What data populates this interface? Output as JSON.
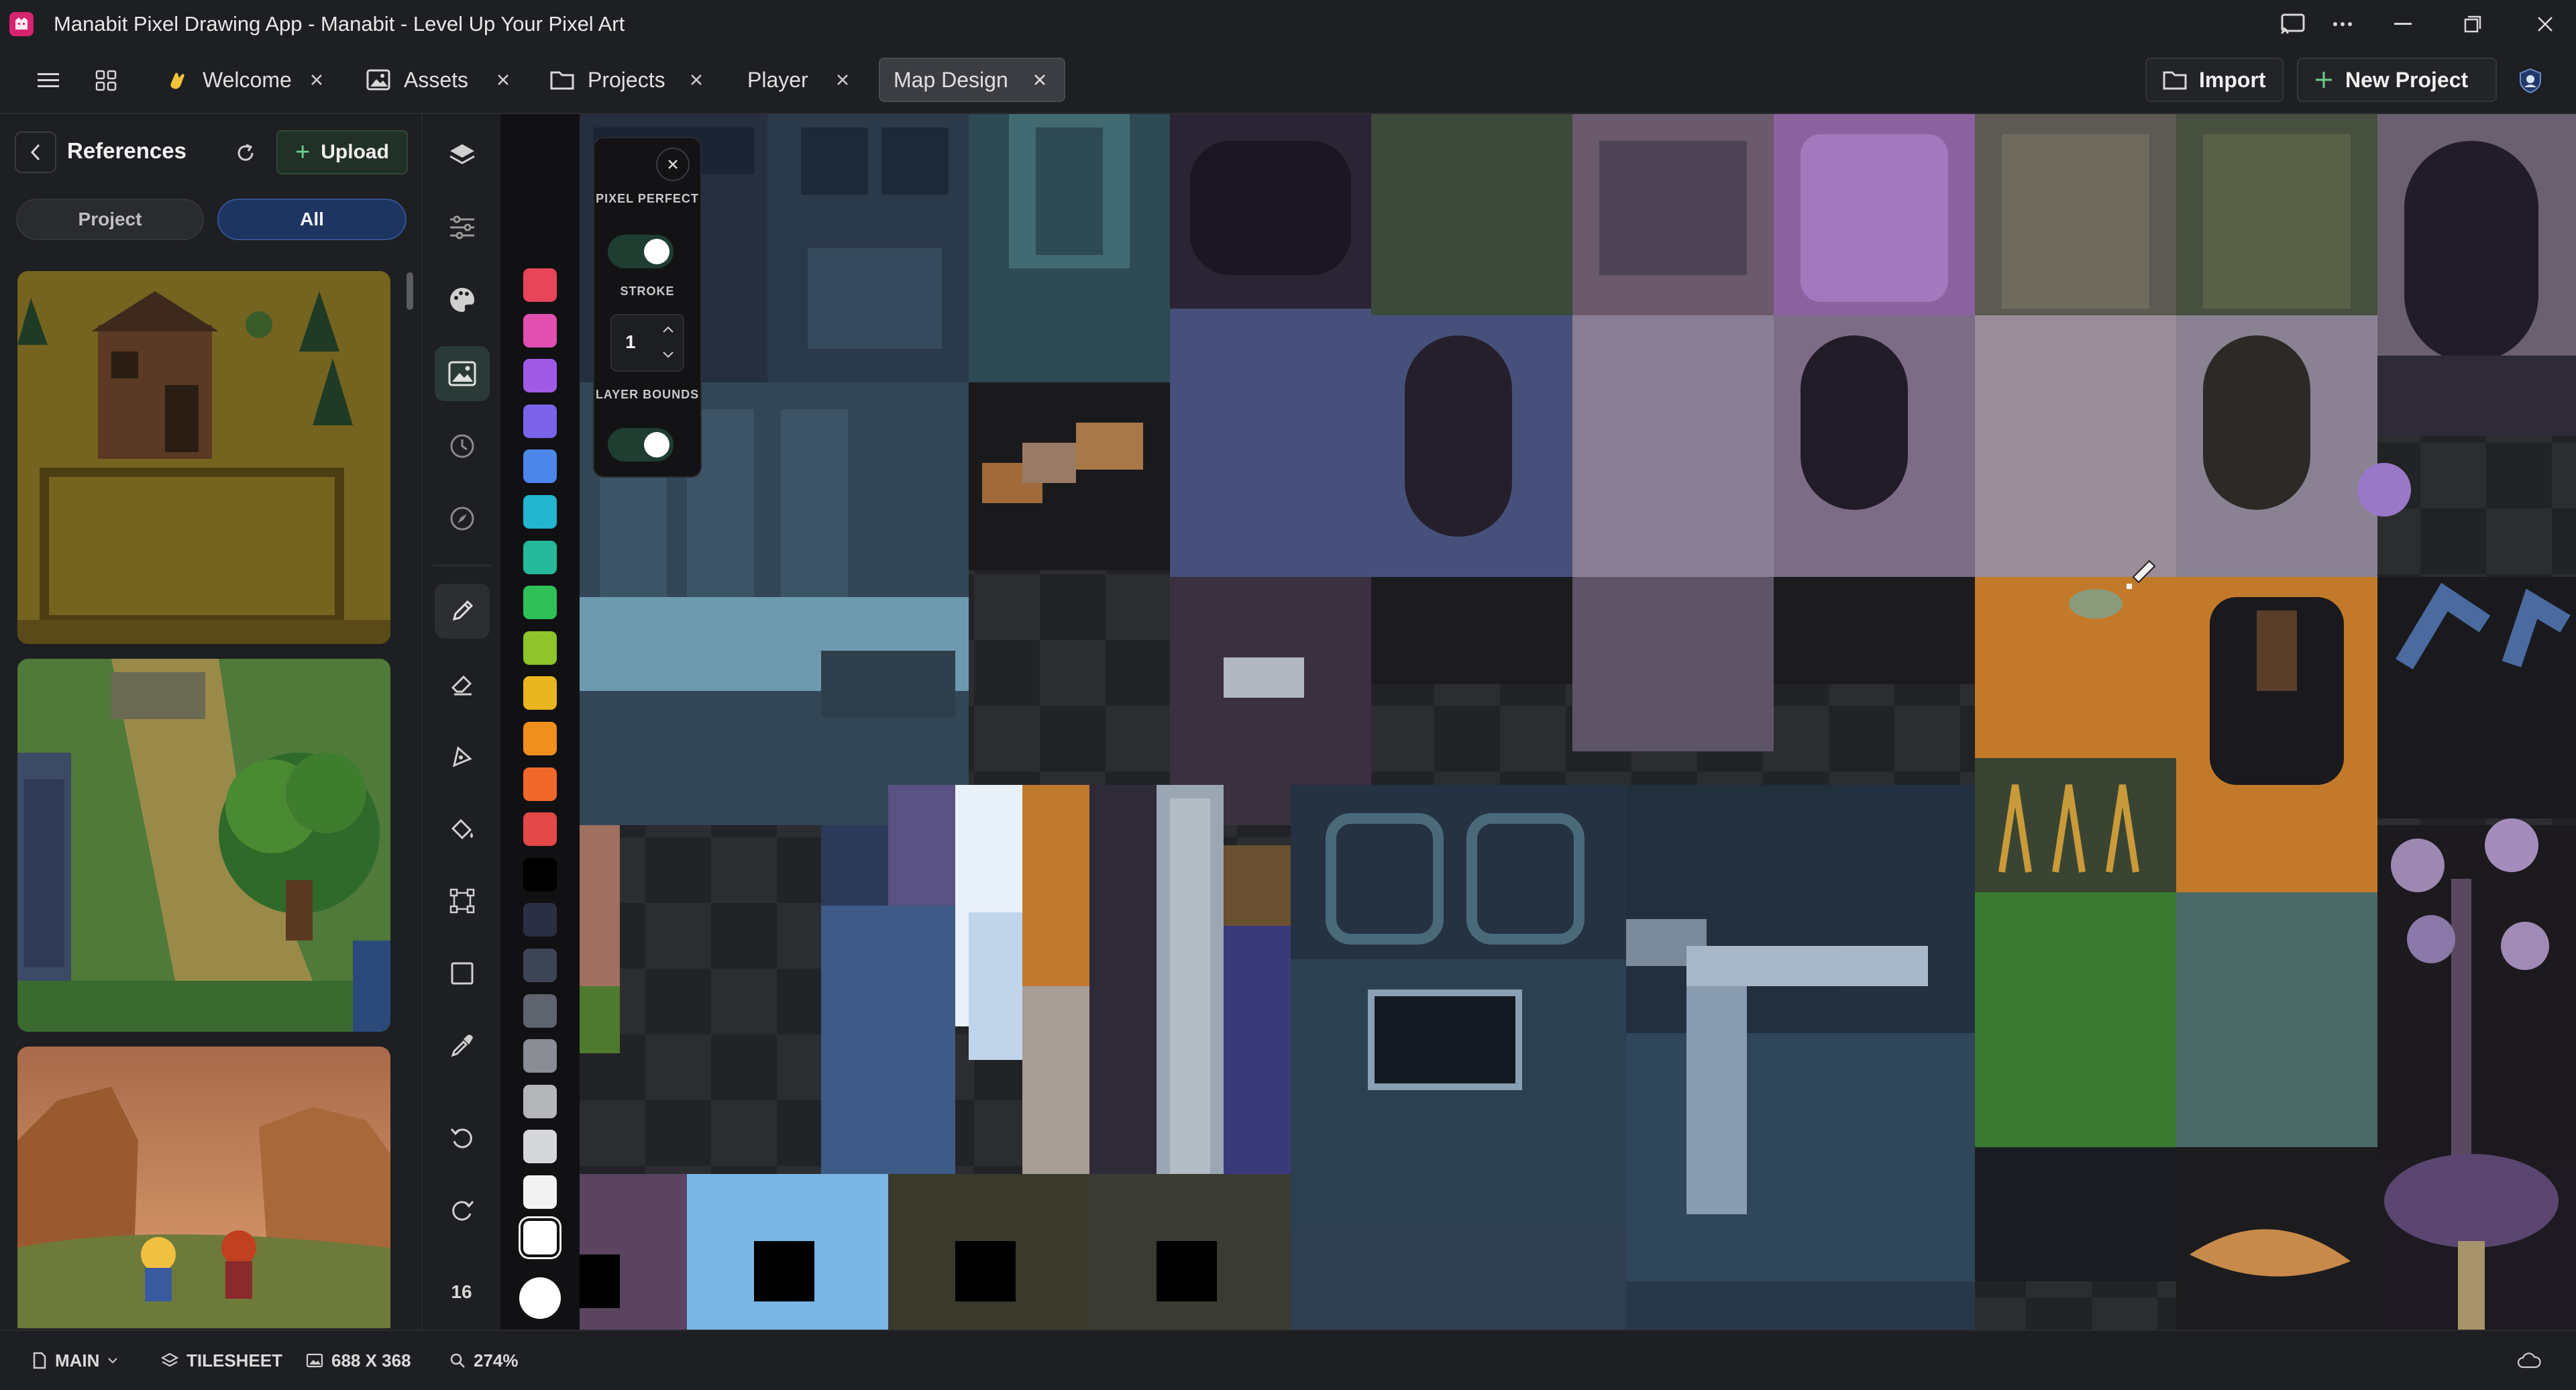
{
  "window": {
    "title": "Manabit Pixel Drawing App - Manabit - Level Up Your Pixel Art",
    "app_icon": "manabit-logo-icon",
    "controls": [
      "cast-icon",
      "more-icon",
      "minimize-icon",
      "restore-icon",
      "close-icon"
    ]
  },
  "tabbar": {
    "tabs": [
      {
        "label": "Welcome",
        "icon": "wave-icon",
        "active": false
      },
      {
        "label": "Assets",
        "icon": "image-icon",
        "active": false
      },
      {
        "label": "Projects",
        "icon": "folder-icon",
        "active": false
      },
      {
        "label": "Player",
        "icon": "",
        "active": false
      },
      {
        "label": "Map Design",
        "icon": "",
        "active": true
      }
    ],
    "import_label": "Import",
    "new_project_label": "New Project"
  },
  "references": {
    "title": "References",
    "upload_label": "Upload",
    "segments": {
      "project": "Project",
      "all": "All",
      "selected": "All"
    }
  },
  "tools": {
    "panel_icons": [
      "layers-icon",
      "adjustments-icon",
      "palette-icon",
      "image-reference-icon",
      "history-icon",
      "compass-icon"
    ],
    "drawing_icons": [
      "pencil-icon",
      "eraser-icon",
      "pen-tool-icon",
      "fill-bucket-icon",
      "transform-icon",
      "rectangle-icon",
      "eyedropper-icon",
      "undo-icon",
      "redo-icon"
    ],
    "selected": "pencil-icon",
    "brush_size": "16"
  },
  "palette": {
    "colors": [
      "#e8455a",
      "#e14fb0",
      "#a05ae6",
      "#7a63ea",
      "#4c86ea",
      "#22b6d0",
      "#26b89a",
      "#2fc05a",
      "#8fc42a",
      "#e8b51f",
      "#f0901c",
      "#f0672a",
      "#e44848",
      "#000000",
      "#2a2f44",
      "#3d4453",
      "#5e636d",
      "#8a8d94",
      "#b4b6ba",
      "#d6d7d9",
      "#f2f2f2",
      "#ffffff"
    ],
    "selected_index": 21
  },
  "stroke_panel": {
    "pixel_perfect_label": "PIXEL PERFECT",
    "pixel_perfect": true,
    "stroke_label": "STROKE",
    "stroke_value": "1",
    "layer_bounds_label": "LAYER BOUNDS",
    "layer_bounds": true
  },
  "statusbar": {
    "layer": "MAIN",
    "mode": "TILESHEET",
    "size": "688 X 368",
    "zoom": "274%"
  },
  "colors": {
    "accent_green": "#6fcf8d",
    "selected_blue": "#1f3561",
    "background": "#1e1f22"
  }
}
